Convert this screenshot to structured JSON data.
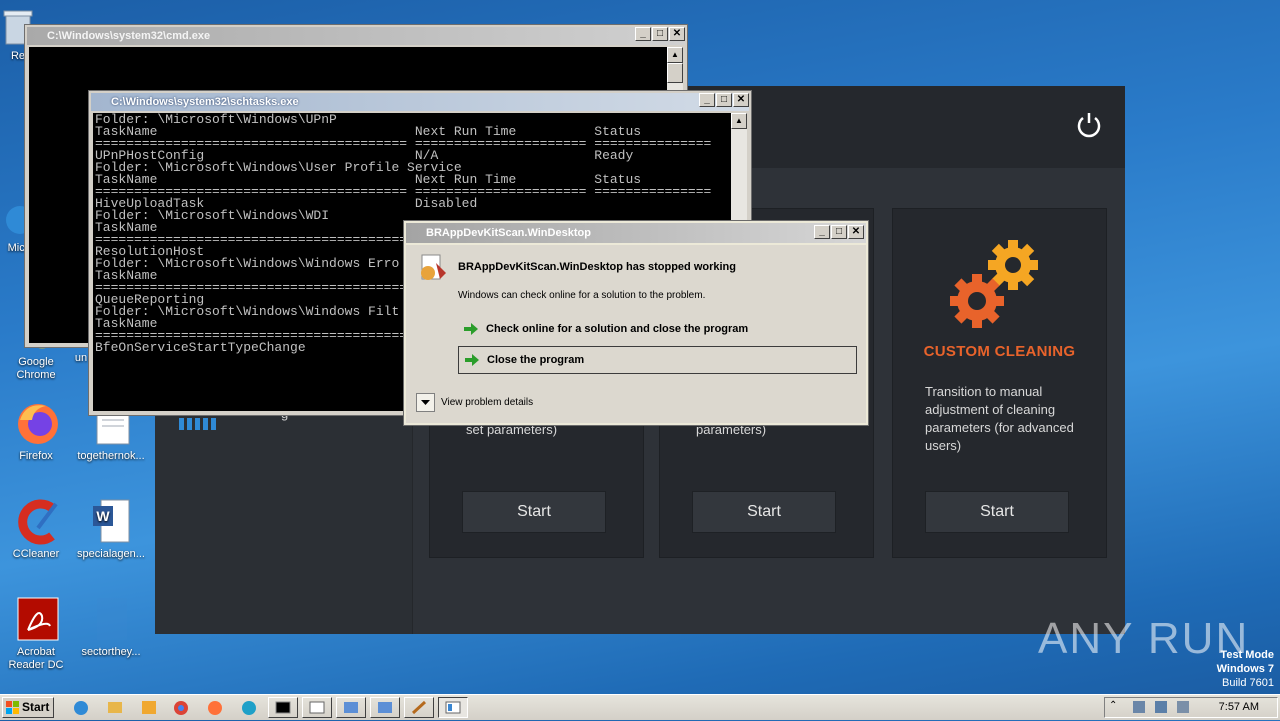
{
  "desktop": {
    "icons": [
      {
        "label": "Re"
      },
      {
        "label": "Micr"
      },
      {
        "label": "Google Chrome"
      },
      {
        "label": "un"
      },
      {
        "label": "Firefox"
      },
      {
        "label": "togethernok..."
      },
      {
        "label": "CCleaner"
      },
      {
        "label": "specialagen..."
      },
      {
        "label": "Acrobat Reader DC"
      },
      {
        "label": "sectorthey..."
      }
    ],
    "watermark": {
      "line1": "Test Mode",
      "line2": "Windows 7",
      "line3": "Build 7601"
    },
    "anyrun": "ANY RUN"
  },
  "app": {
    "cards": [
      {
        "title": "",
        "desc": "set parameters)",
        "start_label": "Start"
      },
      {
        "title": "",
        "desc": "parameters)",
        "start_label": "Start"
      },
      {
        "title": "CUSTOM CLEANING",
        "desc": "Transition to manual adjustment of cleaning parameters (for advanced users)",
        "start_label": "Start"
      }
    ],
    "sidebar_partial": "g",
    "colors": {
      "accent": "#e8632b",
      "background": "#2e3238",
      "card": "#25282d"
    }
  },
  "cmd": {
    "title": "C:\\Windows\\system32\\cmd.exe"
  },
  "schtasks": {
    "title": "C:\\Windows\\system32\\schtasks.exe",
    "lines": [
      "Folder: \\Microsoft\\Windows\\UPnP",
      "TaskName                                 Next Run Time          Status",
      "======================================== ====================== ===============",
      "UPnPHostConfig                           N/A                    Ready",
      "",
      "Folder: \\Microsoft\\Windows\\User Profile Service",
      "TaskName                                 Next Run Time          Status",
      "======================================== ====================== ===============",
      "HiveUploadTask                           Disabled",
      "",
      "Folder: \\Microsoft\\Windows\\WDI",
      "TaskName",
      "========================================",
      "ResolutionHost",
      "",
      "Folder: \\Microsoft\\Windows\\Windows Erro",
      "TaskName",
      "========================================",
      "QueueReporting",
      "",
      "Folder: \\Microsoft\\Windows\\Windows Filt",
      "TaskName",
      "========================================",
      "BfeOnServiceStartTypeChange"
    ]
  },
  "dialog": {
    "title": "BRAppDevKitScan.WinDesktop",
    "heading": "BRAppDevKitScan.WinDesktop has stopped working",
    "message": "Windows can check online for a solution to the problem.",
    "option_check": "Check online for a solution and close the program",
    "option_close": "Close the program",
    "details": "View problem details"
  },
  "taskbar": {
    "start_label": "Start",
    "clock": "7:57 AM"
  }
}
